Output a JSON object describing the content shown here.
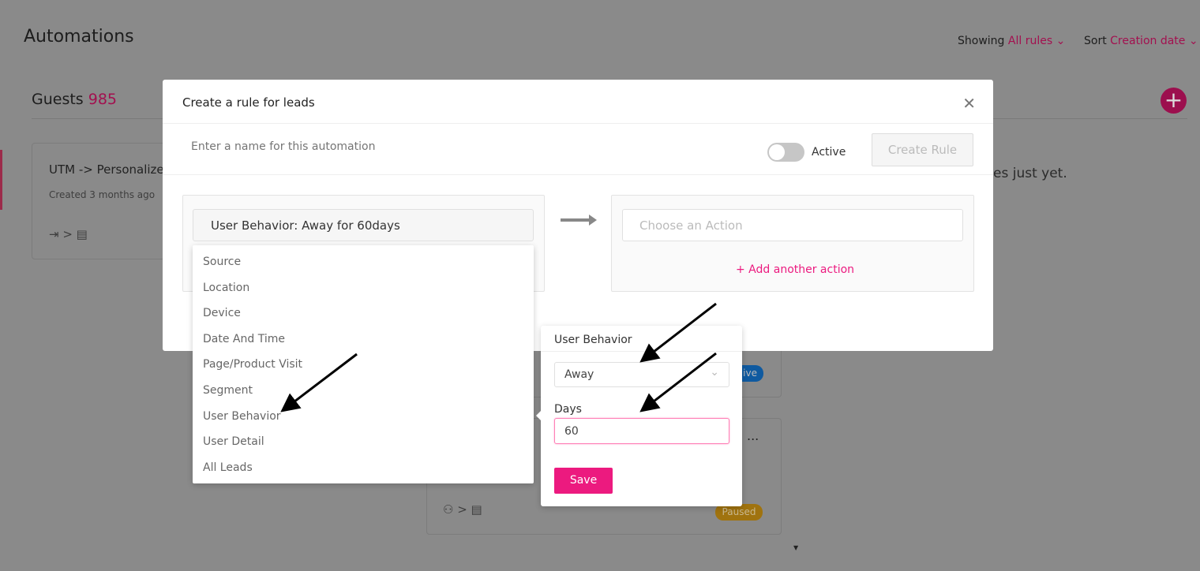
{
  "page": {
    "title": "Automations",
    "showing_label": "Showing",
    "showing_value": "All rules",
    "sort_label": "Sort",
    "sort_value": "Creation date",
    "guests_label": "Guests",
    "guests_count": "985",
    "empty_text": "es just yet."
  },
  "cards": [
    {
      "title": "UTM -> Personalize",
      "created": "Created 3 months ago"
    },
    {
      "badge": "ive",
      "badge_color": "#0f5aa0"
    },
    {
      "menu": "...",
      "badge": "Paused",
      "badge_color": "#a0730f"
    }
  ],
  "modal": {
    "title": "Create a rule for leads",
    "name_placeholder": "Enter a name for this automation",
    "active_label": "Active",
    "active": false,
    "create_label": "Create Rule",
    "condition_value": "User Behavior: Away for 60days",
    "action_placeholder": "Choose an Action",
    "add_action": "+ Add another action",
    "condition_options": [
      "Source",
      "Location",
      "Device",
      "Date And Time",
      "Page/Product Visit",
      "Segment",
      "User Behavior",
      "User Detail",
      "All Leads"
    ]
  },
  "popover": {
    "title": "User Behavior",
    "select_value": "Away",
    "days_label": "Days",
    "days_value": "60",
    "save_label": "Save"
  },
  "colors": {
    "accent": "#ec1a7f",
    "overlay": "#8a8a8a"
  }
}
